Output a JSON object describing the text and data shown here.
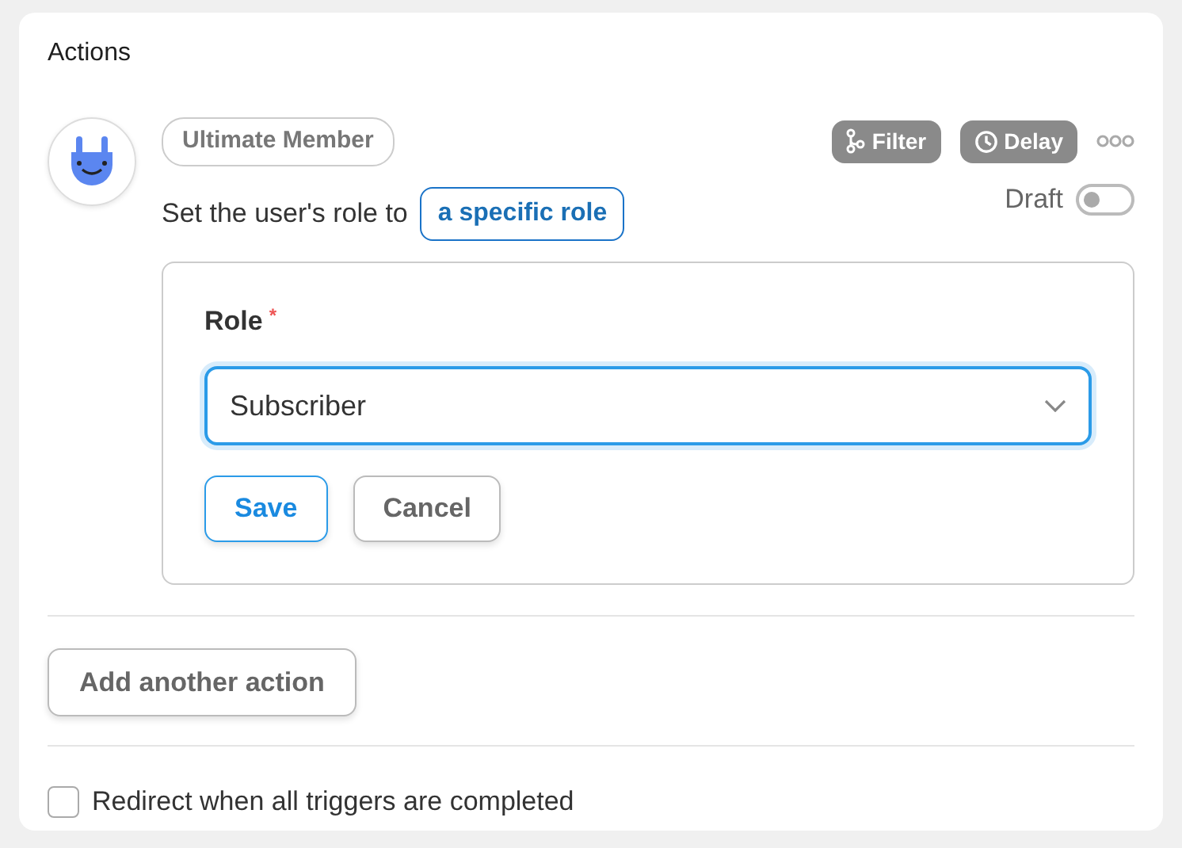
{
  "title": "Actions",
  "action": {
    "app_tag": "Ultimate Member",
    "sentence": "Set the user's role to",
    "role_link": "a specific role",
    "filter": "Filter",
    "delay": "Delay",
    "draft": {
      "label": "Draft",
      "on": false
    },
    "form": {
      "label": "Role",
      "required_mark": "*",
      "select_value": "Subscriber",
      "buttons": [
        {
          "label": "Save",
          "kind": "primary"
        },
        {
          "label": "Cancel",
          "kind": "secondary"
        }
      ]
    }
  },
  "add_button": "Add another action",
  "redirect": {
    "label": "Redirect when all triggers are completed",
    "checked": false
  }
}
